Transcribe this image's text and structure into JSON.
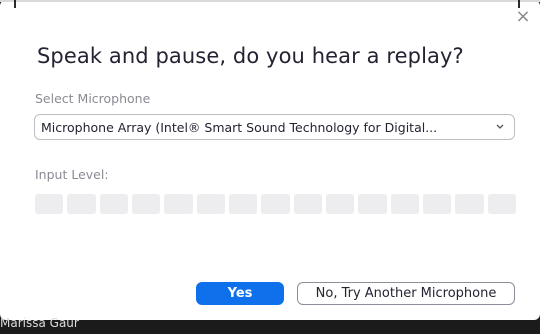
{
  "dialog": {
    "title": "Speak and pause, do you hear a replay?",
    "close_icon": "close-icon",
    "close_glyph": "×",
    "microphone_label": "Select Microphone",
    "microphone_selected": "Microphone Array (Intel® Smart Sound Technology for Digital...",
    "input_level_label": "Input Level:",
    "input_level_segments_lit": 0,
    "yes_button": "Yes",
    "no_button": "No, Try Another Microphone"
  },
  "background": {
    "participant_name": "Marissa Gaur"
  },
  "colors": {
    "accent": "#0e71eb",
    "meter_empty": "#ededf0"
  }
}
